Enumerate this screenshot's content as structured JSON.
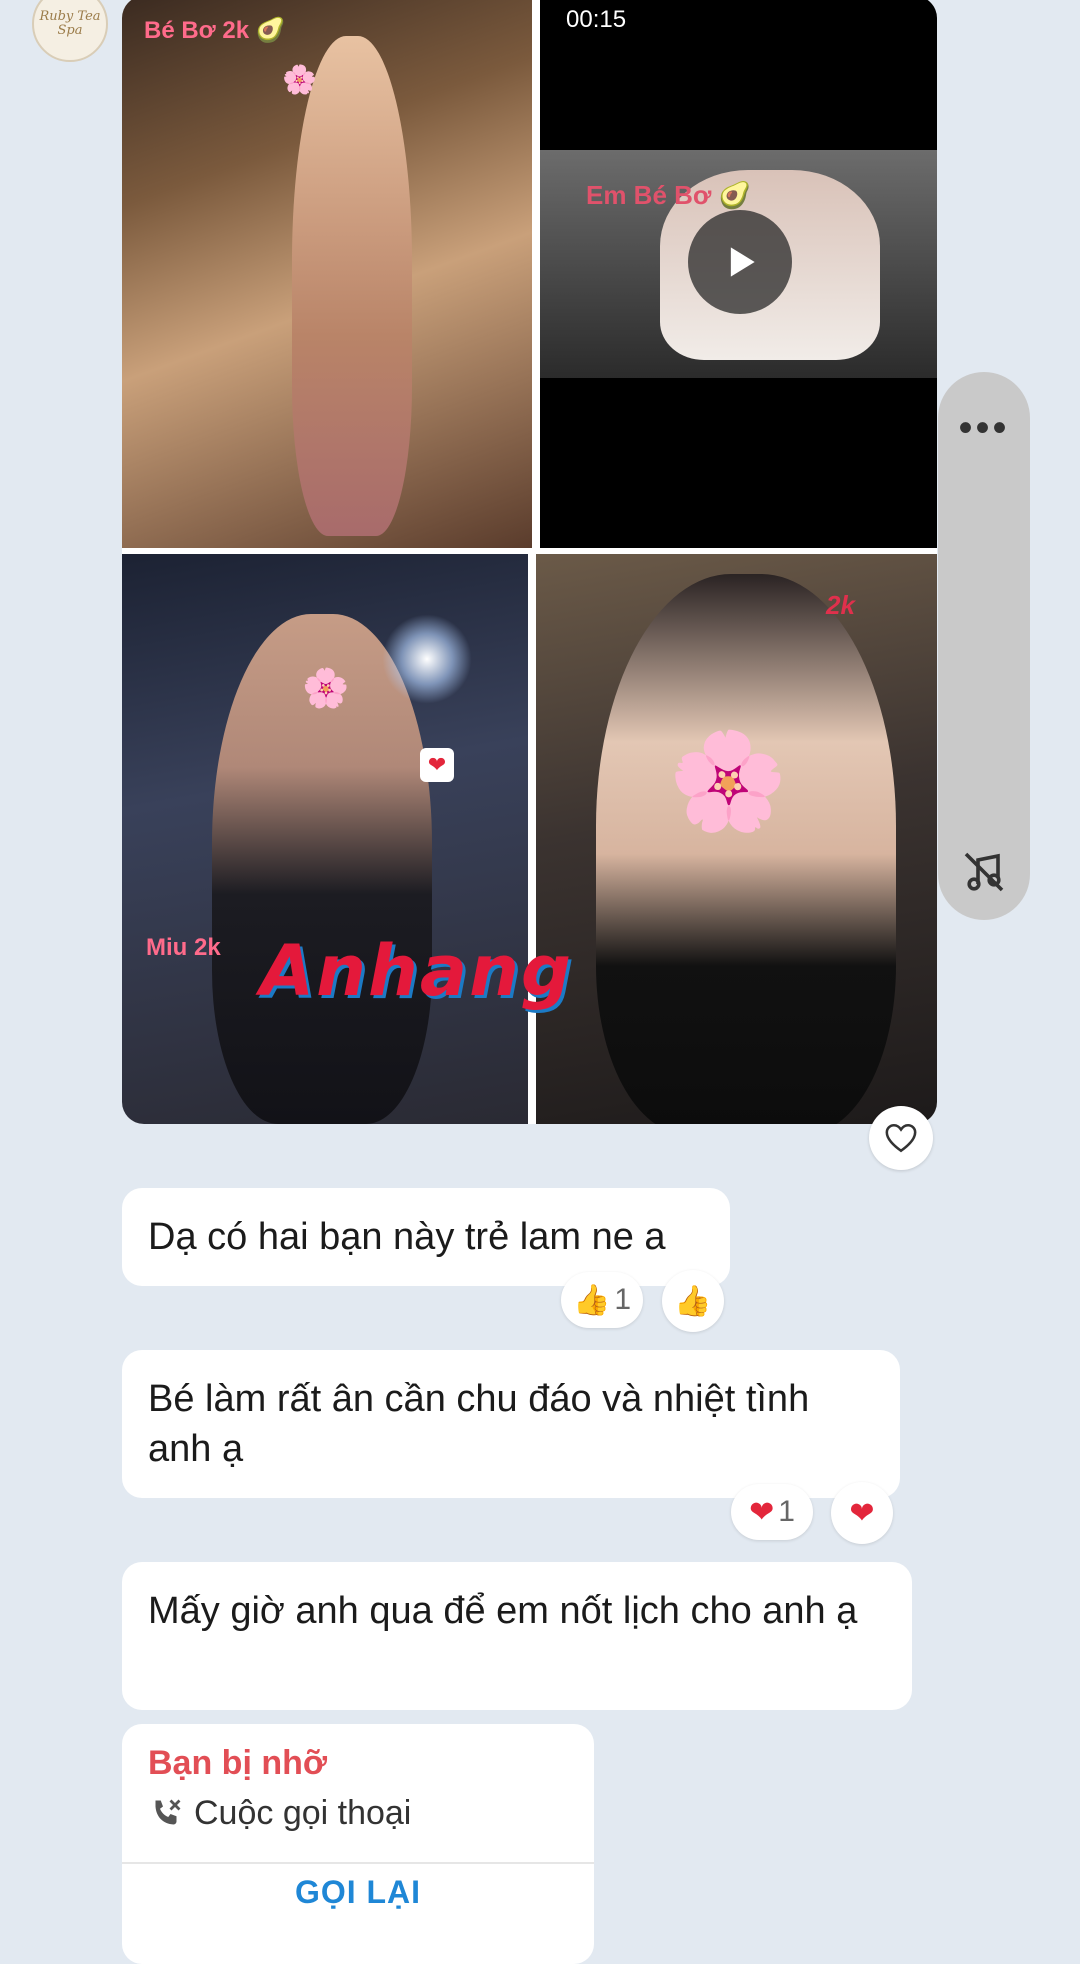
{
  "chat": {
    "sender_avatar_text": "Ruby Tea Spa",
    "media_grid": {
      "photo1_tag": "Bé Bơ 2k 🥑",
      "video_timecode": "00:15",
      "video_tag": "Em Bé Bơ 🥑",
      "photo3_tag": "Miu 2k",
      "photo4_tag": "2k",
      "watermark_text": "Anhang"
    },
    "messages": [
      {
        "text": "Dạ có hai bạn này trẻ lam ne a",
        "reaction_count": "1"
      },
      {
        "text": "Bé làm rất ân cần chu đáo và nhiệt tình anh ạ",
        "reaction_count": "1"
      },
      {
        "text": "Mấy giờ anh qua để em nốt lịch cho anh ạ"
      }
    ],
    "missed_call": {
      "title": "Bạn bị nhỡ",
      "subtitle": "Cuộc gọi thoại",
      "action": "GỌI LẠI"
    }
  },
  "icons": {
    "reaction1": "thumbs-up-icon",
    "reaction2": "heart-icon",
    "call": "missed-call-icon",
    "side_top": "more-dots-icon",
    "side_bottom": "mute-icon"
  },
  "colors": {
    "background": "#e2e9f1",
    "missed_call_title": "#e24e55",
    "callback_action": "#1f87d6"
  }
}
